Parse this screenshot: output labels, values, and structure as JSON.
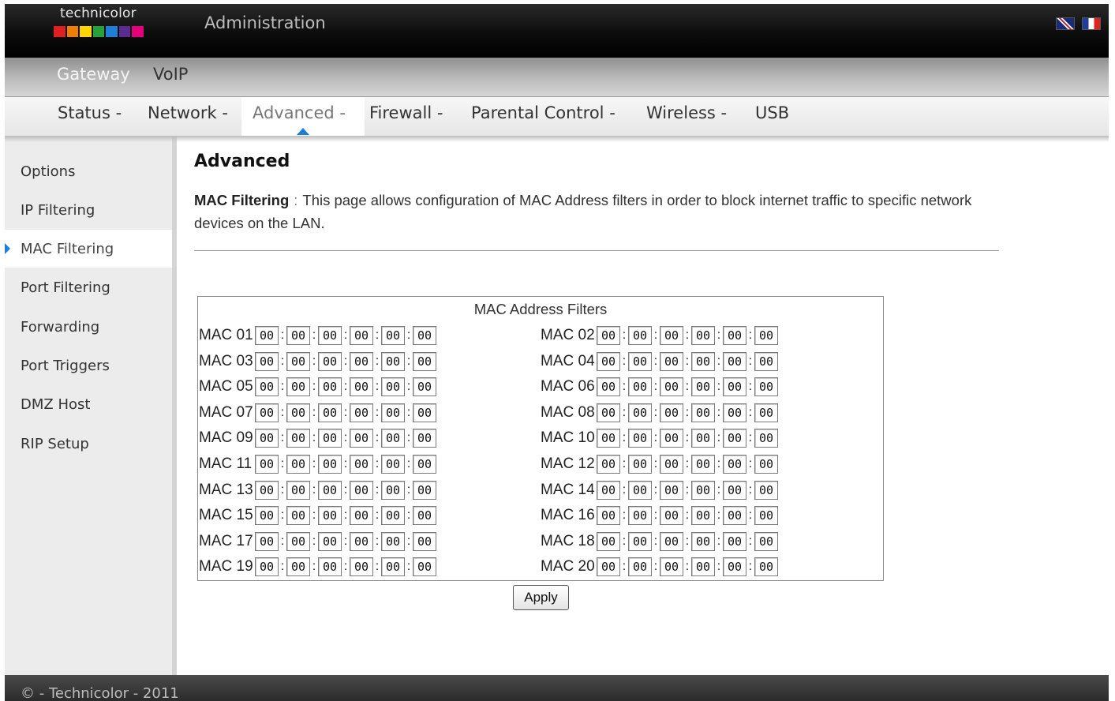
{
  "header": {
    "logo_text": "technicolor",
    "logo_colors": [
      "#e02020",
      "#f07d00",
      "#ffd400",
      "#28a03c",
      "#1f7fd6",
      "#5a2c91",
      "#e3007a"
    ],
    "app_title": "Administration",
    "languages": [
      {
        "code": "en",
        "icon": "uk-flag-icon"
      },
      {
        "code": "fr",
        "icon": "fr-flag-icon"
      }
    ]
  },
  "topnav": {
    "items": [
      {
        "label": "Gateway",
        "active": true
      },
      {
        "label": "VoIP",
        "active": false
      }
    ]
  },
  "subnav": {
    "items": [
      {
        "label": "Status -",
        "active": false
      },
      {
        "label": "Network -",
        "active": false
      },
      {
        "label": "Advanced -",
        "active": true
      },
      {
        "label": "Firewall -",
        "active": false
      },
      {
        "label": "Parental Control -",
        "active": false
      },
      {
        "label": "Wireless -",
        "active": false
      },
      {
        "label": "USB",
        "active": false
      }
    ]
  },
  "sidebar": {
    "items": [
      {
        "label": "Options",
        "active": false
      },
      {
        "label": "IP Filtering",
        "active": false
      },
      {
        "label": "MAC Filtering",
        "active": true
      },
      {
        "label": "Port Filtering",
        "active": false
      },
      {
        "label": "Forwarding",
        "active": false
      },
      {
        "label": "Port Triggers",
        "active": false
      },
      {
        "label": "DMZ Host",
        "active": false
      },
      {
        "label": "RIP Setup",
        "active": false
      }
    ]
  },
  "main": {
    "title": "Advanced",
    "desc_label": "MAC Filtering",
    "desc_sep": ":",
    "desc_text": "This page allows configuration of MAC Address filters in order to block internet traffic to specific network devices on the LAN."
  },
  "mac_table": {
    "title": "MAC Address Filters",
    "entries": [
      {
        "label": "MAC 01",
        "octets": [
          "00",
          "00",
          "00",
          "00",
          "00",
          "00"
        ]
      },
      {
        "label": "MAC 02",
        "octets": [
          "00",
          "00",
          "00",
          "00",
          "00",
          "00"
        ]
      },
      {
        "label": "MAC 03",
        "octets": [
          "00",
          "00",
          "00",
          "00",
          "00",
          "00"
        ]
      },
      {
        "label": "MAC 04",
        "octets": [
          "00",
          "00",
          "00",
          "00",
          "00",
          "00"
        ]
      },
      {
        "label": "MAC 05",
        "octets": [
          "00",
          "00",
          "00",
          "00",
          "00",
          "00"
        ]
      },
      {
        "label": "MAC 06",
        "octets": [
          "00",
          "00",
          "00",
          "00",
          "00",
          "00"
        ]
      },
      {
        "label": "MAC 07",
        "octets": [
          "00",
          "00",
          "00",
          "00",
          "00",
          "00"
        ]
      },
      {
        "label": "MAC 08",
        "octets": [
          "00",
          "00",
          "00",
          "00",
          "00",
          "00"
        ]
      },
      {
        "label": "MAC 09",
        "octets": [
          "00",
          "00",
          "00",
          "00",
          "00",
          "00"
        ]
      },
      {
        "label": "MAC 10",
        "octets": [
          "00",
          "00",
          "00",
          "00",
          "00",
          "00"
        ]
      },
      {
        "label": "MAC 11",
        "octets": [
          "00",
          "00",
          "00",
          "00",
          "00",
          "00"
        ]
      },
      {
        "label": "MAC 12",
        "octets": [
          "00",
          "00",
          "00",
          "00",
          "00",
          "00"
        ]
      },
      {
        "label": "MAC 13",
        "octets": [
          "00",
          "00",
          "00",
          "00",
          "00",
          "00"
        ]
      },
      {
        "label": "MAC 14",
        "octets": [
          "00",
          "00",
          "00",
          "00",
          "00",
          "00"
        ]
      },
      {
        "label": "MAC 15",
        "octets": [
          "00",
          "00",
          "00",
          "00",
          "00",
          "00"
        ]
      },
      {
        "label": "MAC 16",
        "octets": [
          "00",
          "00",
          "00",
          "00",
          "00",
          "00"
        ]
      },
      {
        "label": "MAC 17",
        "octets": [
          "00",
          "00",
          "00",
          "00",
          "00",
          "00"
        ]
      },
      {
        "label": "MAC 18",
        "octets": [
          "00",
          "00",
          "00",
          "00",
          "00",
          "00"
        ]
      },
      {
        "label": "MAC 19",
        "octets": [
          "00",
          "00",
          "00",
          "00",
          "00",
          "00"
        ]
      },
      {
        "label": "MAC 20",
        "octets": [
          "00",
          "00",
          "00",
          "00",
          "00",
          "00"
        ]
      }
    ],
    "separator": ":",
    "apply_label": "Apply"
  },
  "footer": {
    "text": "© - Technicolor - 2011"
  }
}
